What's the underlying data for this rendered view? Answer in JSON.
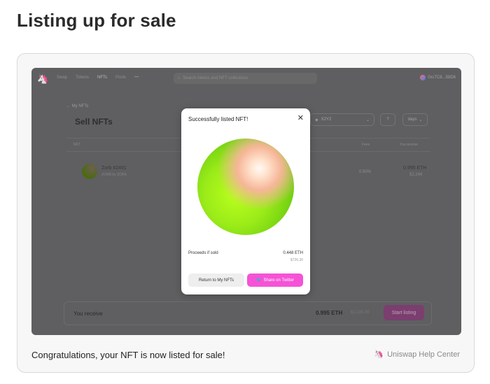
{
  "page": {
    "title": "Listing up for sale"
  },
  "caption": "Congratulations, your NFT is now listed for sale!",
  "help": {
    "label": "Uniswap Help Center",
    "icon": "uniswap-unicorn-icon"
  },
  "app": {
    "nav": [
      "Swap",
      "Tokens",
      "NFTs",
      "Pools",
      "•••"
    ],
    "search_placeholder": "Search tokens and NFT collections",
    "wallet": "0xc7C8...58D6",
    "back_label": "My NFTs",
    "section_title": "Sell NFTs",
    "marketplace": "X2Y2",
    "marketplace_qty": "?",
    "duration": "days",
    "table": {
      "headers": {
        "nft": "NFT",
        "fees": "Fees",
        "proceeds": "You receive"
      },
      "rows": [
        {
          "name": "Zorb #2491",
          "collection": "ZORB by ZORA",
          "fee": "0.50%",
          "price": "0.995 ETH",
          "usd": "$2,246"
        }
      ]
    },
    "footer": {
      "receive_label": "You receive",
      "eth": "0.995 ETH",
      "usd": "$2,235.06",
      "start_button": "Start listing"
    }
  },
  "modal": {
    "title": "Successfully listed NFT!",
    "proceeds_label": "Proceeds if sold",
    "proceeds_eth": "0.448 ETH",
    "proceeds_usd": "$726.30",
    "return_button": "Return to My NFTs",
    "share_button": "Share on Twitter"
  },
  "colors": {
    "accent_pink": "#f553d6",
    "overlay": "#5f5f61",
    "orb_green": "#9cec19",
    "orb_peach": "#f6b698"
  }
}
